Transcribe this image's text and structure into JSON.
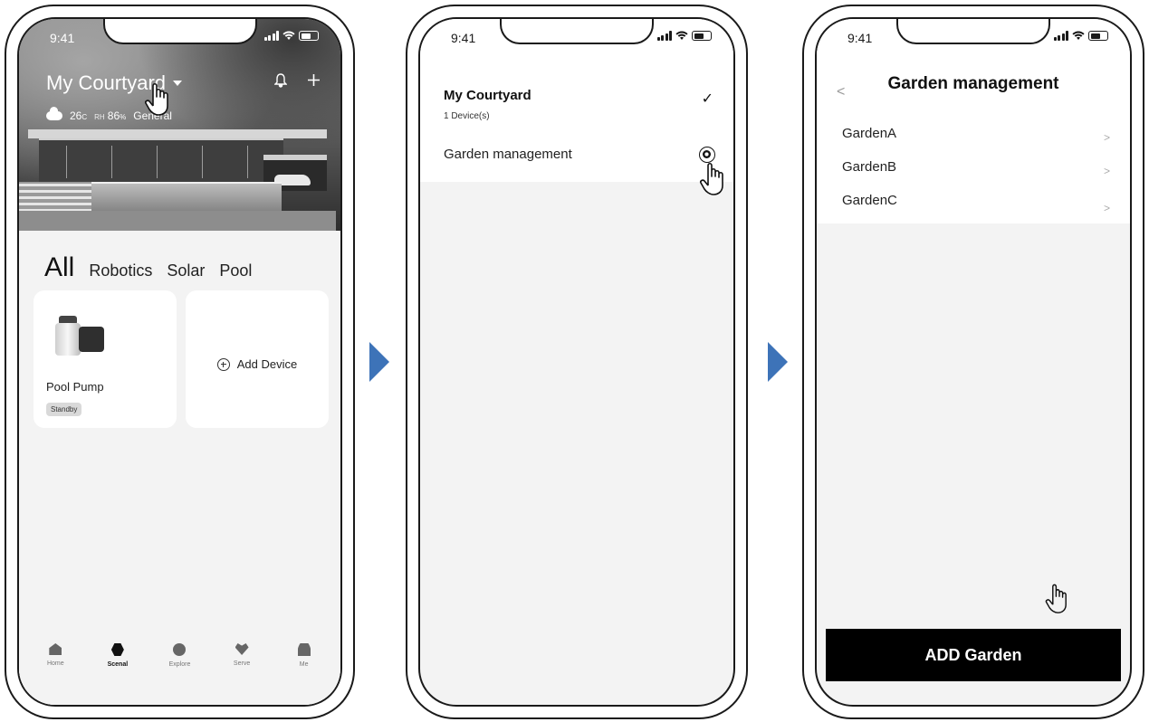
{
  "phone1": {
    "status": {
      "time": "9:41"
    },
    "header": {
      "location": "My Courtyard"
    },
    "weather": {
      "temp": "26",
      "temp_unit": "C",
      "rh_label": "RH",
      "rh_value": "86",
      "rh_unit": "%",
      "aqi_value": "General"
    },
    "category_tabs": [
      "All",
      "Robotics",
      "Solar",
      "Pool"
    ],
    "device_card": {
      "name": "Pool Pump",
      "status": "Standby"
    },
    "add_device_label": "Add Device",
    "tab_bar": [
      {
        "label": "Home",
        "icon": "home-icon"
      },
      {
        "label": "Scenal",
        "icon": "scene-icon",
        "active": true
      },
      {
        "label": "Explore",
        "icon": "explore-icon"
      },
      {
        "label": "Serve",
        "icon": "heart-icon"
      },
      {
        "label": "Me",
        "icon": "person-icon"
      }
    ]
  },
  "phone2": {
    "status": {
      "time": "9:41"
    },
    "courtyard": {
      "name": "My Courtyard",
      "devices": "1 Device(s)",
      "check_icon": "check-icon"
    },
    "menu": {
      "garden_management": "Garden management",
      "icon": "gear-icon"
    }
  },
  "phone3": {
    "status": {
      "time": "9:41"
    },
    "title": "Garden management",
    "back_icon": "chevron-left-icon",
    "gardens": [
      {
        "name": "GardenA"
      },
      {
        "name": "GardenB"
      },
      {
        "name": "GardenC"
      }
    ],
    "add_button": "ADD Garden"
  },
  "colors": {
    "arrow": "#3d73b8",
    "button": "#000000",
    "screen_bg": "#f3f3f3"
  }
}
